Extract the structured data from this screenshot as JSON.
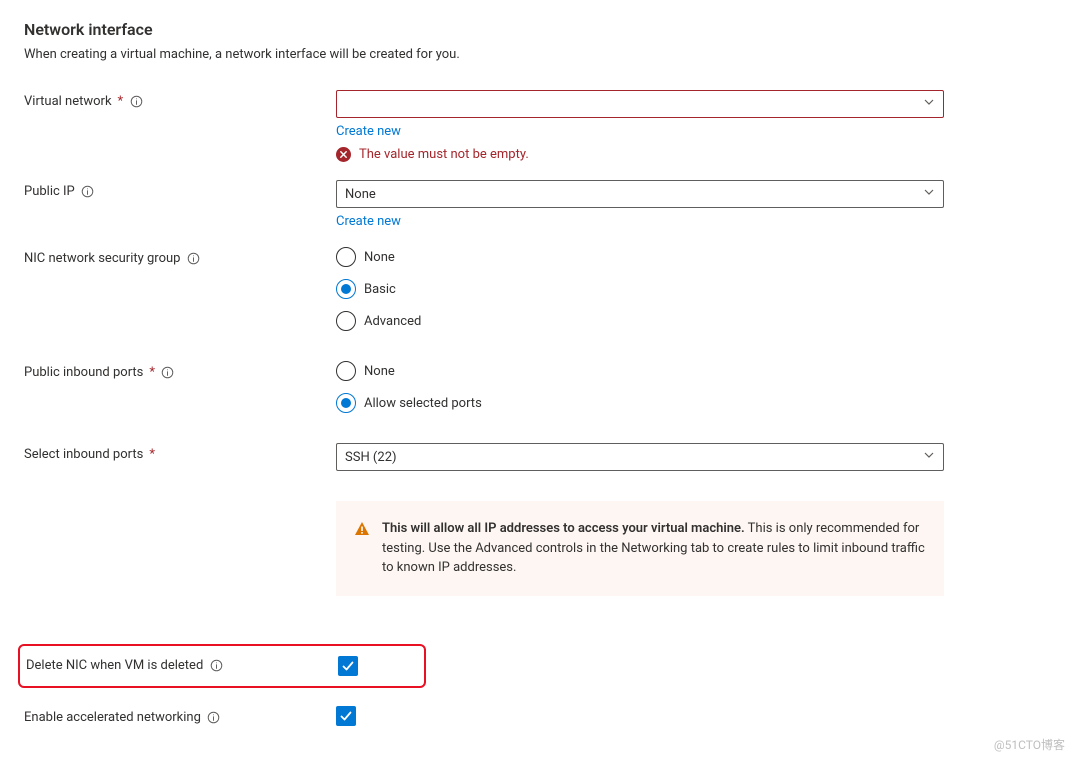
{
  "section": {
    "title": "Network interface",
    "description": "When creating a virtual machine, a network interface will be created for you."
  },
  "virtualNetwork": {
    "label": "Virtual network",
    "value": "",
    "createNew": "Create new",
    "error": "The value must not be empty."
  },
  "publicIp": {
    "label": "Public IP",
    "value": "None",
    "createNew": "Create new"
  },
  "nsg": {
    "label": "NIC network security group",
    "options": {
      "none": "None",
      "basic": "Basic",
      "advanced": "Advanced"
    },
    "selected": "basic"
  },
  "inboundPorts": {
    "label": "Public inbound ports",
    "options": {
      "none": "None",
      "allow": "Allow selected ports"
    },
    "selected": "allow"
  },
  "selectInbound": {
    "label": "Select inbound ports",
    "value": "SSH (22)"
  },
  "warning": {
    "bold": "This will allow all IP addresses to access your virtual machine.",
    "text": " This is only recommended for testing.  Use the Advanced controls in the Networking tab to create rules to limit inbound traffic to known IP addresses."
  },
  "deleteNic": {
    "label": "Delete NIC when VM is deleted",
    "checked": true
  },
  "accelNet": {
    "label": "Enable accelerated networking",
    "checked": true
  },
  "watermark": "@51CTO博客"
}
